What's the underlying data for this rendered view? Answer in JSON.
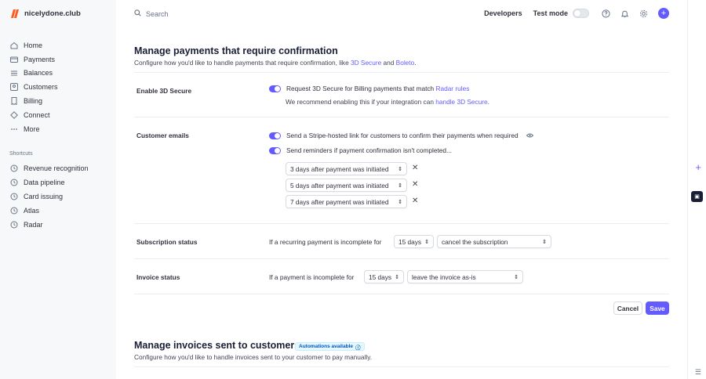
{
  "brand": {
    "name": "nicelydone.club"
  },
  "search": {
    "placeholder": "Search"
  },
  "topbar": {
    "developers": "Developers",
    "test_mode": "Test mode"
  },
  "sidebar": {
    "items": [
      {
        "label": "Home",
        "icon": "home-icon"
      },
      {
        "label": "Payments",
        "icon": "payments-icon"
      },
      {
        "label": "Balances",
        "icon": "balances-icon"
      },
      {
        "label": "Customers",
        "icon": "customers-icon"
      },
      {
        "label": "Billing",
        "icon": "billing-icon"
      },
      {
        "label": "Connect",
        "icon": "connect-icon"
      },
      {
        "label": "More",
        "icon": "more-icon"
      }
    ],
    "shortcuts_title": "Shortcuts",
    "shortcuts": [
      {
        "label": "Revenue recognition"
      },
      {
        "label": "Data pipeline"
      },
      {
        "label": "Card issuing"
      },
      {
        "label": "Atlas"
      },
      {
        "label": "Radar"
      }
    ]
  },
  "section1": {
    "title": "Manage payments that require confirmation",
    "subtitle_pre": "Configure how you'd like to handle payments that require confirmation, like ",
    "link1": "3D Secure",
    "and": " and ",
    "link2": "Boleto",
    "period": "."
  },
  "secure": {
    "label": "Enable 3D Secure",
    "option_pre": "Request 3D Secure for Billing payments that match ",
    "option_link": "Radar rules",
    "note_pre": "We recommend enabling this if your integration can ",
    "note_link": "handle 3D Secure",
    "note_post": "."
  },
  "emails": {
    "label": "Customer emails",
    "option1": "Send a Stripe-hosted link for customers to confirm their payments when required",
    "option2": "Send reminders if payment confirmation isn't completed...",
    "reminders": [
      "3 days after payment was initiated",
      "5 days after payment was initiated",
      "7 days after payment was initiated"
    ]
  },
  "subscription": {
    "label": "Subscription status",
    "text": "If a recurring payment is incomplete for",
    "days": "15 days",
    "action": "cancel the subscription"
  },
  "invoice": {
    "label": "Invoice status",
    "text": "If a payment is incomplete for",
    "days": "15 days",
    "action": "leave the invoice as-is"
  },
  "actions": {
    "cancel": "Cancel",
    "save": "Save"
  },
  "section2": {
    "title": "Manage invoices sent to customers",
    "badge": "Automations available",
    "subtitle": "Configure how you'd like to handle invoices sent to your customer to pay manually."
  },
  "colors": {
    "accent": "#635bff",
    "brand_orange": "#ff5a1f"
  }
}
